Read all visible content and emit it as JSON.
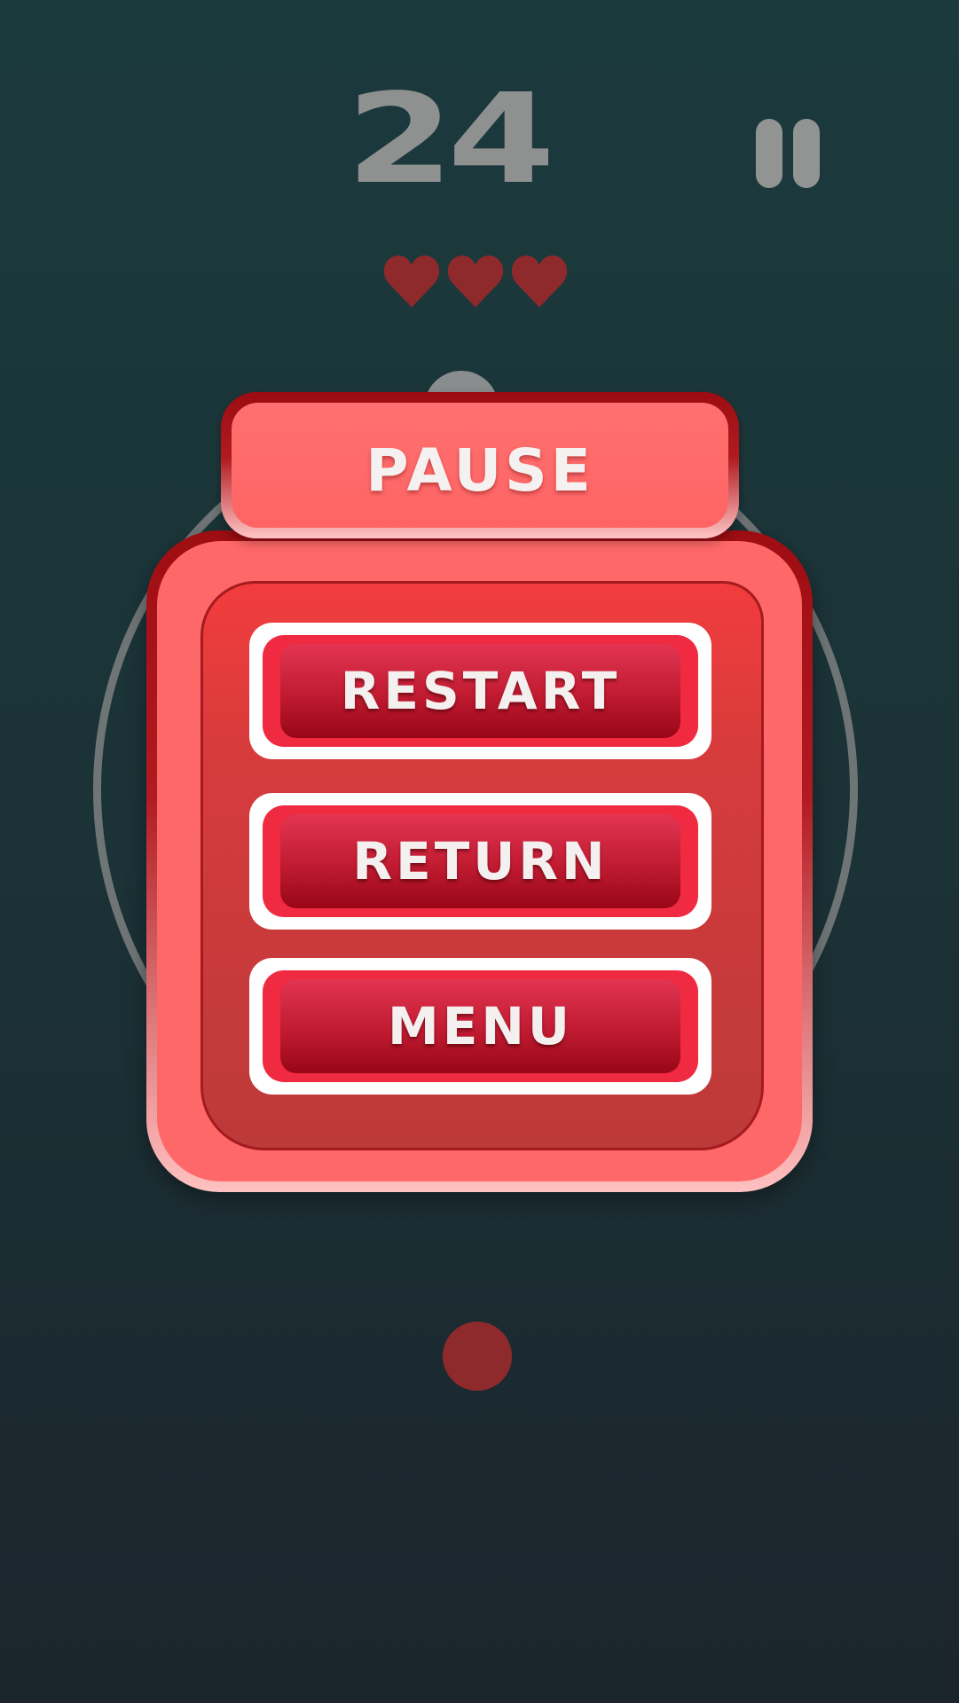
{
  "hud": {
    "score": "24",
    "lives": 3,
    "pause_icon": "pause-icon",
    "life_icon": "heart-icon",
    "life_color": "#8e2a2c"
  },
  "pause_dialog": {
    "title": "PAUSE",
    "buttons": [
      {
        "label": "RESTART"
      },
      {
        "label": "RETURN"
      },
      {
        "label": "MENU"
      }
    ]
  },
  "colors": {
    "background_top": "#1b3a3d",
    "background_bottom": "#1b252c",
    "panel": "#ff6868",
    "button_face": "#c41d34",
    "ring": "#6f7576"
  }
}
